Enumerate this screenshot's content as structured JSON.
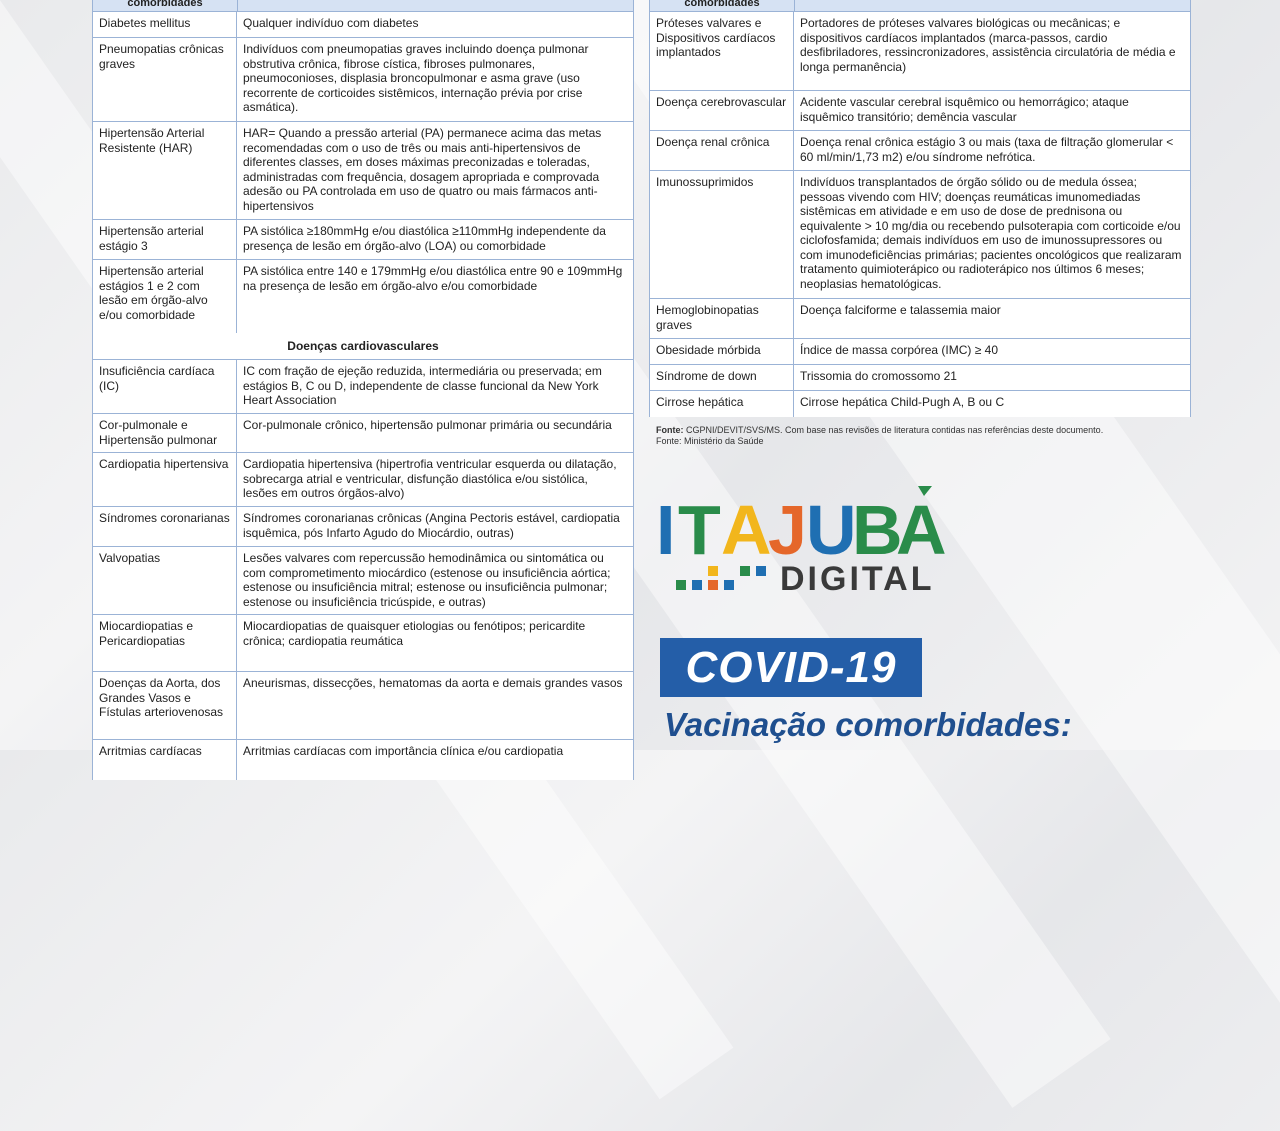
{
  "left_table": {
    "header_left": "comorbidades",
    "rows_top": [
      {
        "name": "Diabetes mellitus",
        "desc": "Qualquer indivíduo com diabetes"
      },
      {
        "name": "Pneumopatias crônicas graves",
        "desc": "Indivíduos com pneumopatias graves incluindo doença pulmonar obstrutiva crônica, fibrose cística, fibroses pulmonares, pneumoconioses, displasia broncopulmonar e asma grave (uso recorrente de corticoides sistêmicos, internação prévia por crise asmática)."
      },
      {
        "name": "Hipertensão Arterial Resistente (HAR)",
        "desc": "HAR= Quando a pressão arterial (PA) permanece acima das metas recomendadas com o uso de três ou mais anti-hipertensivos de diferentes classes, em doses máximas preconizadas e toleradas, administradas com frequência, dosagem apropriada e comprovada adesão ou PA controlada em uso de quatro ou mais fármacos anti-hipertensivos"
      },
      {
        "name": "Hipertensão arterial estágio 3",
        "desc": "PA sistólica ≥180mmHg e/ou diastólica ≥110mmHg independente da presença de lesão em órgão-alvo (LOA) ou comorbidade"
      },
      {
        "name": "Hipertensão arterial estágios 1 e 2 com lesão em órgão-alvo e/ou comorbidade",
        "desc": "PA sistólica entre 140 e 179mmHg e/ou diastólica entre 90 e 109mmHg na presença de lesão em órgão-alvo e/ou comorbidade"
      }
    ],
    "section_title": "Doenças cardiovasculares",
    "rows_cardio": [
      {
        "name": "Insuficiência cardíaca (IC)",
        "desc": "IC com fração de ejeção reduzida, intermediária ou preservada; em estágios B, C ou D, independente de classe funcional da New York Heart Association"
      },
      {
        "name": "Cor-pulmonale e Hipertensão pulmonar",
        "desc": "Cor-pulmonale crônico, hipertensão pulmonar primária ou secundária"
      },
      {
        "name": "Cardiopatia hipertensiva",
        "desc": "Cardiopatia hipertensiva (hipertrofia ventricular esquerda ou dilatação, sobrecarga atrial e ventricular, disfunção diastólica e/ou sistólica, lesões em outros órgãos-alvo)"
      },
      {
        "name": "Síndromes coronarianas",
        "desc": "Síndromes coronarianas crônicas (Angina Pectoris estável, cardiopatia isquêmica, pós Infarto Agudo do Miocárdio, outras)"
      },
      {
        "name": "Valvopatias",
        "desc": "Lesões valvares com repercussão hemodinâmica ou sintomática ou com comprometimento miocárdico (estenose ou insuficiência aórtica; estenose ou insuficiência mitral; estenose ou insuficiência pulmonar; estenose ou insuficiência tricúspide, e outras)"
      },
      {
        "name": "Miocardiopatias e Pericardiopatias",
        "desc": "Miocardiopatias de quaisquer etiologias ou fenótipos; pericardite crônica; cardiopatia reumática"
      },
      {
        "name": "Doenças da Aorta, dos Grandes Vasos e Fístulas arteriovenosas",
        "desc": "Aneurismas, dissecções, hematomas da aorta e demais grandes vasos"
      },
      {
        "name": "Arritmias cardíacas",
        "desc": "Arritmias cardíacas com importância clínica e/ou cardiopatia"
      }
    ]
  },
  "right_table": {
    "header_left": "comorbidades",
    "rows": [
      {
        "name": "Próteses valvares e Dispositivos cardíacos implantados",
        "desc": "Portadores de próteses valvares biológicas ou mecânicas; e dispositivos cardíacos implantados (marca-passos, cardio desfibriladores, ressincronizadores, assistência circulatória de média e longa permanência)"
      },
      {
        "name": "Doença cerebrovascular",
        "desc": "Acidente vascular cerebral isquêmico ou hemorrágico; ataque isquêmico transitório; demência vascular"
      },
      {
        "name": "Doença renal crônica",
        "desc": "Doença renal crônica estágio 3 ou mais (taxa de filtração glomerular < 60 ml/min/1,73 m2) e/ou síndrome nefrótica."
      },
      {
        "name": "Imunossuprimidos",
        "desc": "Indivíduos transplantados de órgão sólido ou de medula óssea; pessoas vivendo com HIV; doenças reumáticas imunomediadas sistêmicas em atividade e em uso de dose de prednisona ou equivalente > 10 mg/dia ou recebendo pulsoterapia com corticoide e/ou ciclofosfamida; demais indivíduos em uso de imunossupressores ou com imunodeficiências primárias; pacientes oncológicos que realizaram tratamento quimioterápico ou radioterápico nos últimos 6 meses; neoplasias hematológicas."
      },
      {
        "name": "Hemoglobinopatias graves",
        "desc": "Doença falciforme e talassemia maior"
      },
      {
        "name": "Obesidade mórbida",
        "desc": "Índice de massa corpórea (IMC) ≥ 40"
      },
      {
        "name": "Síndrome de down",
        "desc": "Trissomia do cromossomo 21"
      },
      {
        "name": "Cirrose hepática",
        "desc": "Cirrose hepática Child-Pugh A, B ou C"
      }
    ]
  },
  "source": {
    "line1_label": "Fonte:",
    "line1_text": " CGPNI/DEVIT/SVS/MS. Com base nas revisões de literatura contidas nas referências deste documento.",
    "line2": "Fonte: Ministério da Saúde"
  },
  "logo": {
    "name": "ITAJUBÁ",
    "sub": "DIGITAL"
  },
  "banner": {
    "covid": "COVID-19",
    "title": "Vacinação comorbidades:"
  },
  "colors": {
    "border": "#9bb3d6",
    "header_bg": "#d6e2f3",
    "banner": "#245ea8",
    "title": "#1f4f8f"
  }
}
